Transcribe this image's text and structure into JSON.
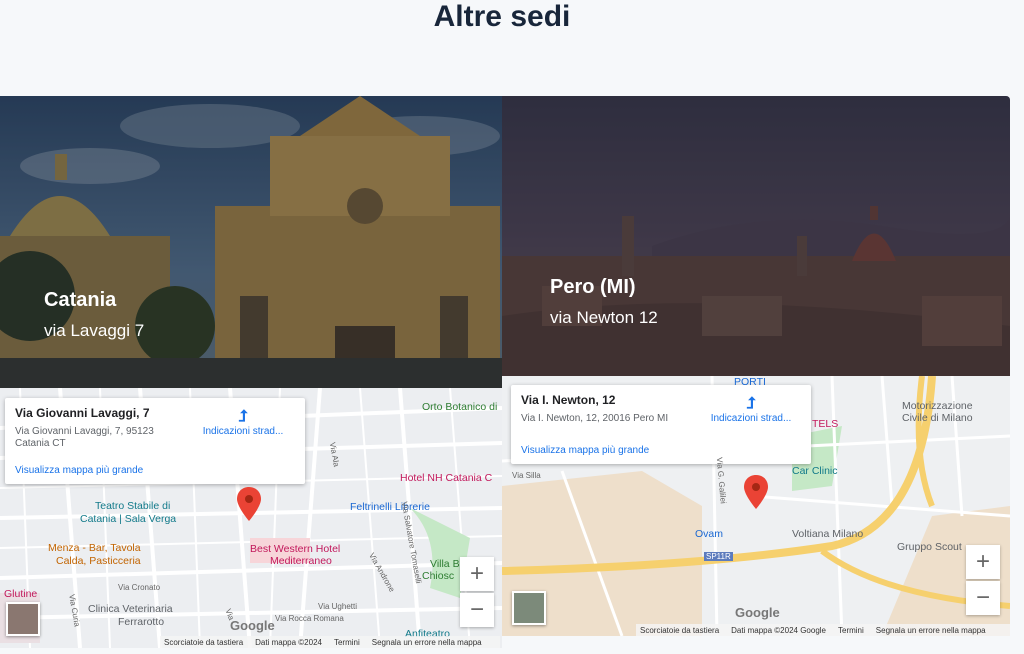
{
  "heading": "Altre sedi",
  "locations": [
    {
      "city": "Catania",
      "street": "via Lavaggi 7",
      "map": {
        "info_title": "Via Giovanni Lavaggi, 7",
        "info_address_1": "Via Giovanni Lavaggi, 7, 95123",
        "info_address_2": "Catania CT",
        "directions": "Indicazioni strad...",
        "larger_map": "Visualizza mappa più grande",
        "pois": [
          "Orto Botanico di",
          "Hotel NH Catania C",
          "Feltrinelli Librerie",
          "Teatro Stabile di",
          "Catania | Sala Verga",
          "Menza - Bar, Tavola",
          "Calda, Pasticceria",
          "Best Western Hotel",
          "Mediterraneo",
          "Villa B",
          "Chiosc",
          "Clinica Veterinaria",
          "Ferrarotto",
          "Glutine",
          "Anfiteatro"
        ],
        "roads": [
          "Via Ala",
          "Via Salvatore Tomaselli",
          "Via Androne",
          "Via Cronato",
          "Via Ughetti",
          "Via Rocca Romana",
          "Via Curia",
          "Via"
        ],
        "footer": [
          "Scorciatoie da tastiera",
          "Dati mappa ©2024",
          "Termini",
          "Segnala un errore nella mappa"
        ],
        "logo": "Google",
        "zoom_in": "+",
        "zoom_out": "−"
      }
    },
    {
      "city": "Pero (MI)",
      "street": "via Newton 12",
      "map": {
        "info_title": "Via I. Newton, 12",
        "info_address_1": "Via I. Newton, 12, 20016 Pero MI",
        "directions": "Indicazioni strad...",
        "larger_map": "Visualizza mappa più grande",
        "pois": [
          "Motorizzazione",
          "Civile di Milano",
          "TELS",
          "Car Clinic",
          "Ovam",
          "Voltiana Milano",
          "Gruppo Scout",
          "PORTI"
        ],
        "roads": [
          "Via Silla",
          "Via G. Galilei",
          "SP11R"
        ],
        "footer": [
          "Scorciatoie da tastiera",
          "Dati mappa ©2024 Google",
          "Termini",
          "Segnala un errore nella mappa"
        ],
        "logo": "Google",
        "zoom_in": "+",
        "zoom_out": "−"
      }
    }
  ],
  "colors": {
    "heading": "#18263a",
    "link": "#1a73e8",
    "marker": "#ea4335",
    "highway": "#f6d06e"
  }
}
